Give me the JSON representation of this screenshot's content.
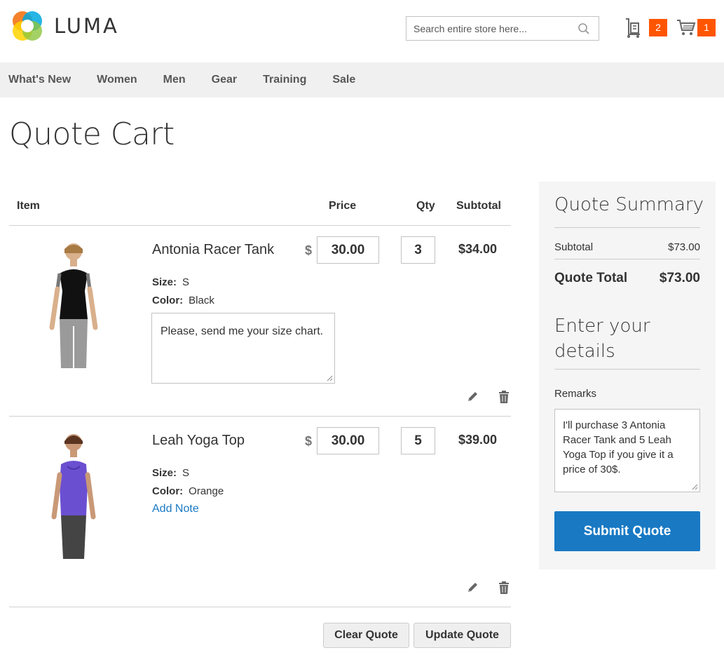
{
  "header": {
    "logo_text": "LUMA",
    "search_placeholder": "Search entire store here...",
    "quote_count": "2",
    "cart_count": "1",
    "colors": {
      "badge": "#ff5501",
      "accent": "#1979c3"
    }
  },
  "nav": {
    "items": [
      "What's New",
      "Women",
      "Men",
      "Gear",
      "Training",
      "Sale"
    ]
  },
  "page_title": "Quote Cart",
  "table": {
    "headers": {
      "item": "Item",
      "price": "Price",
      "qty": "Qty",
      "subtotal": "Subtotal"
    },
    "currency": "$",
    "rows": [
      {
        "name": "Antonia Racer Tank",
        "price": "30.00",
        "qty": "3",
        "subtotal": "$34.00",
        "size_label": "Size:",
        "size": "S",
        "color_label": "Color:",
        "color": "Black",
        "note": "Please, send me your size chart."
      },
      {
        "name": "Leah Yoga Top",
        "price": "30.00",
        "qty": "5",
        "subtotal": "$39.00",
        "size_label": "Size:",
        "size": "S",
        "color_label": "Color:",
        "color": "Orange",
        "add_note": "Add Note"
      }
    ]
  },
  "buttons": {
    "clear": "Clear Quote",
    "update": "Update Quote"
  },
  "summary": {
    "title": "Quote Summary",
    "subtotal_label": "Subtotal",
    "subtotal_value": "$73.00",
    "total_label": "Quote Total",
    "total_value": "$73.00",
    "details_title": "Enter your details",
    "remarks_label": "Remarks",
    "remarks_value": "I'll purchase 3 Antonia Racer Tank and 5 Leah Yoga Top if you give it a price of 30$.",
    "submit": "Submit Quote"
  },
  "icons": [
    "search-icon",
    "quote-cart-icon",
    "shopping-cart-icon",
    "edit-icon",
    "trash-icon",
    "resize-grip-icon"
  ]
}
